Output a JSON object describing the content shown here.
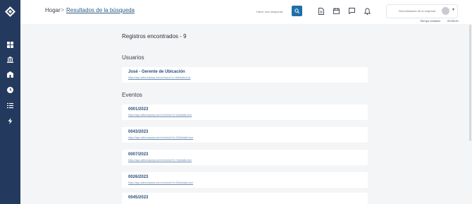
{
  "header": {
    "breadcrumb": {
      "home": "Hogar",
      "separator": ">",
      "current": "Resultados de la búsqueda"
    },
    "search": {
      "placeholder": "Hacer una búsqueda"
    },
    "company": {
      "label": "Denominación de la empresa"
    },
    "session": {
      "label": "Tiempo restante:",
      "value": "09:58:49"
    }
  },
  "sidebar": {
    "items": [
      {
        "icon": "dashboard-icon"
      },
      {
        "icon": "bank-icon"
      },
      {
        "icon": "building-icon"
      },
      {
        "icon": "clock-icon"
      },
      {
        "icon": "list-icon"
      },
      {
        "icon": "lightning-icon"
      }
    ]
  },
  "main": {
    "results_title": "Registros encontrados - 9",
    "users_title": "Usuarios",
    "users": [
      {
        "name": "José - Gerente de Ubicación",
        "link": "https://app.safecompany.com.br/users/?u=1&details=true"
      }
    ],
    "events_title": "Eventos",
    "events": [
      {
        "id": "0001/2023",
        "link": "https://app.safecompany.com.br/events/?e=1&details=true"
      },
      {
        "id": "0043/2023",
        "link": "https://app.safecompany.com.br/events/?e=43&details=true"
      },
      {
        "id": "0007/2023",
        "link": "https://app.safecompany.com.br/events/?e=7&details=true"
      },
      {
        "id": "0026/2023",
        "link": "https://app.safecompany.com.br/events/?e=26&details=true"
      },
      {
        "id": "0045/2023",
        "link": "https://app.safecompany.com.br/events/?e=45&details=true"
      }
    ]
  },
  "colors": {
    "sidebar": "#24395e",
    "accent": "#1f6fa8",
    "link": "#2d5b86"
  }
}
